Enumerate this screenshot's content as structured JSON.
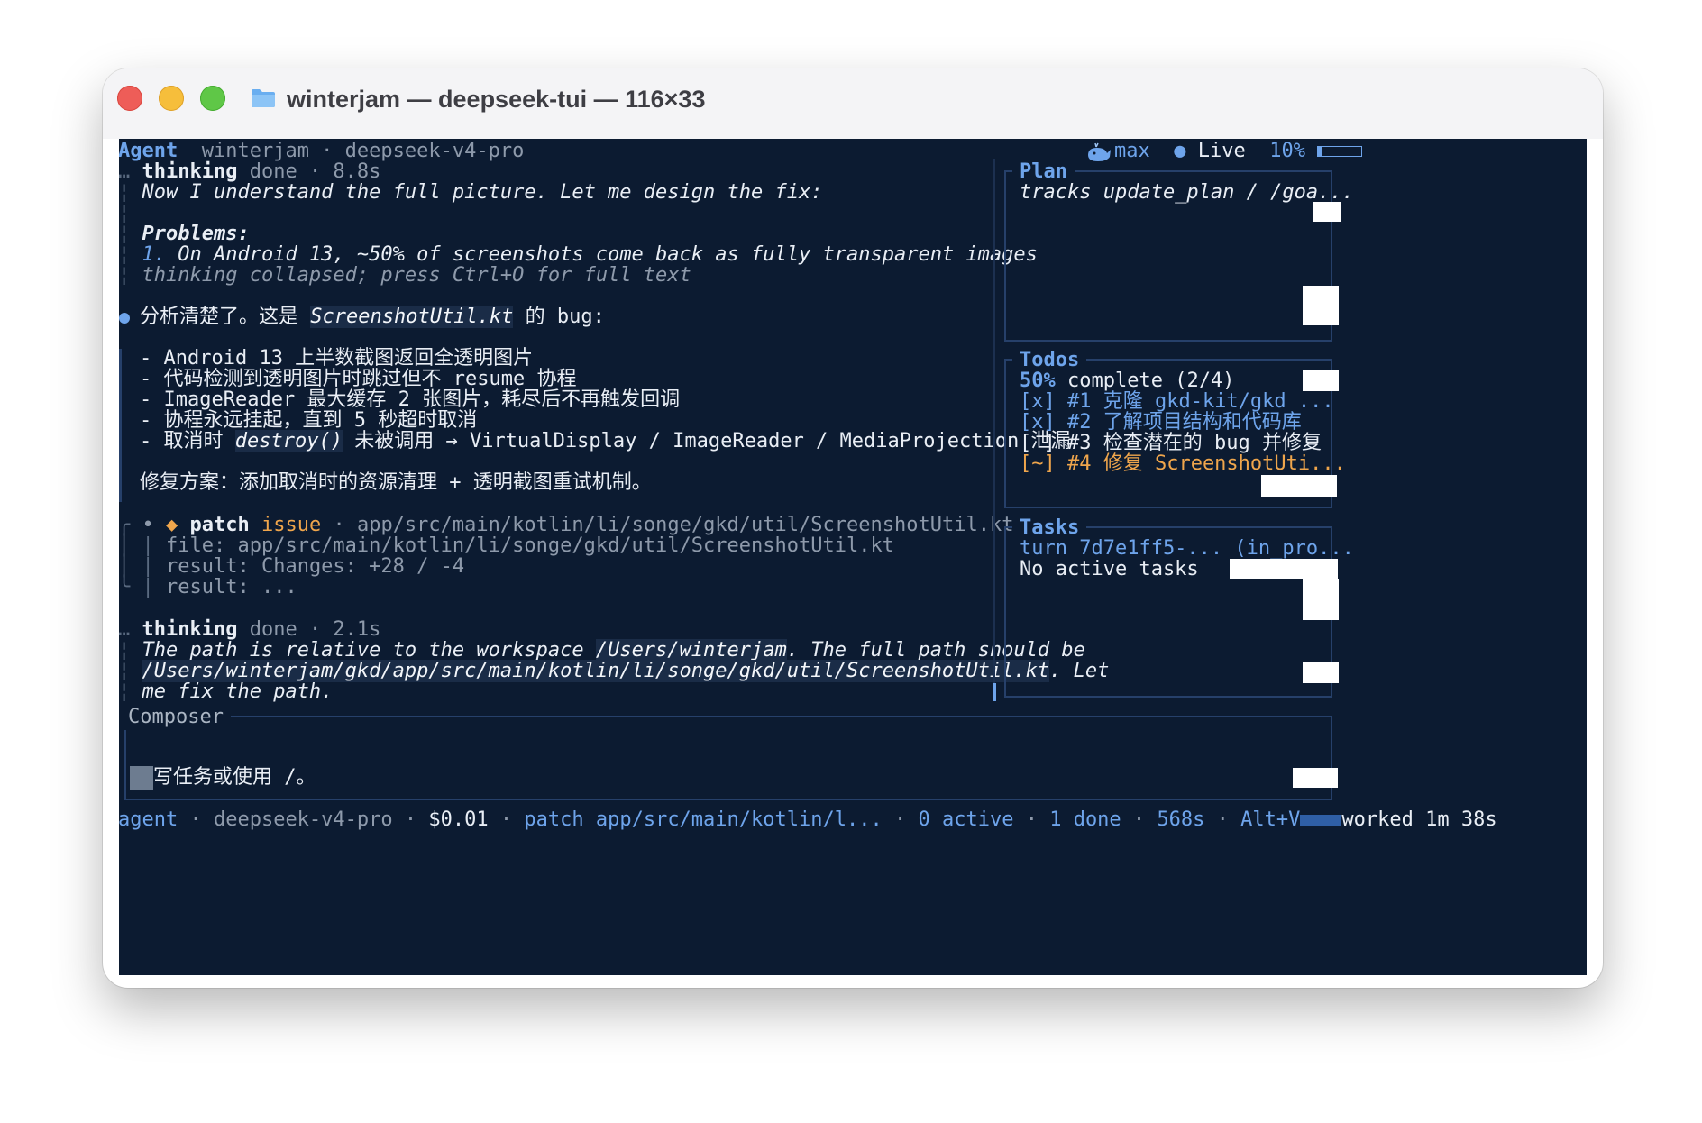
{
  "window": {
    "title": "winterjam — deepseek-tui — 116×33"
  },
  "header": {
    "mode": "Agent",
    "context": "winterjam · deepseek-v4-pro",
    "effort": "max",
    "live_label": "Live",
    "usage_percent": "10%",
    "usage_fraction": 0.1,
    "whale_icon": "whale-icon"
  },
  "transcript": {
    "thinking1": {
      "label": "thinking",
      "status": "done · 8.8s",
      "line1": "Now I understand the full picture. Let me design the fix:",
      "problems_heading": "Problems:",
      "problem1_num": "1.",
      "problem1": " On Android 13, ~50% of screenshots come back as fully transparent images",
      "collapsed_note": "thinking collapsed; press Ctrl+O for full text"
    },
    "message": {
      "intro_prefix": "分析清楚了。这是 ",
      "intro_file": "ScreenshotUtil.kt",
      "intro_suffix": " 的 bug:",
      "bullets": [
        "- Android 13 上半数截图返回全透明图片",
        "- 代码检测到透明图片时跳过但不 resume 协程",
        "- ImageReader 最大缓存 2 张图片，耗尽后不再触发回调",
        "- 协程永远挂起，直到 5 秒超时取消"
      ],
      "bullet5_prefix": "- 取消时 ",
      "bullet5_code": "destroy()",
      "bullet5_suffix": " 未被调用 → VirtualDisplay / ImageReader / MediaProjection 泄漏",
      "fix_plan": "修复方案：添加取消时的资源清理 + 透明截图重试机制。"
    },
    "patch": {
      "label": "patch",
      "status": "issue",
      "path": " · app/src/main/kotlin/li/songe/gkd/util/ScreenshotUtil.kt",
      "file_line": "file: app/src/main/kotlin/li/songe/gkd/util/ScreenshotUtil.kt",
      "result1": "result: Changes: +28 / -4",
      "result2": "result: ..."
    },
    "thinking2": {
      "label": "thinking",
      "status": "done · 2.1s",
      "line1_prefix": "The path is relative to the workspace ",
      "line1_path": "/Users/winterjam",
      "line1_suffix": ". The full path should be",
      "line2_path": "/Users/winterjam/gkd/app/src/main/kotlin/li/songe/gkd/util/ScreenshotUtil.kt",
      "line2_suffix": ". Let",
      "line3": "me fix the path."
    }
  },
  "sidebar": {
    "plan": {
      "title": "Plan",
      "text": "tracks update_plan / /goa..."
    },
    "todos": {
      "title": "Todos",
      "progress_percent": "50%",
      "progress_text": " complete (2/4)",
      "items": [
        {
          "text": "[x] #1 克隆 gkd-kit/gkd ...",
          "state": "done"
        },
        {
          "text": "[x] #2 了解项目结构和代码库",
          "state": "done"
        },
        {
          "text": "[ ] #3 检查潜在的 bug 并修复",
          "state": "pending"
        },
        {
          "text": "[~] #4 修复 ScreenshotUti...",
          "state": "active"
        }
      ]
    },
    "tasks": {
      "title": "Tasks",
      "turn": "turn 7d7e1ff5-... (in_pro...",
      "empty": "No active tasks"
    }
  },
  "composer": {
    "title": "Composer",
    "placeholder": "写任务或使用 /。"
  },
  "status_bar": {
    "mode": "agent",
    "model": " · deepseek-v4-pro · ",
    "cost": "$0.01",
    "sep1": " · ",
    "patch": "patch app/src/main/kotlin/l...",
    "sep2": " · ",
    "active": "0 active",
    "sep3": " · ",
    "done": "1 done",
    "sep4": " · ",
    "elapsed": "568s",
    "sep5": " · ",
    "shortcut": "Alt+V",
    "worked": "worked 1m 38s"
  },
  "colors": {
    "terminal_bg": "#0c1b31",
    "accent_blue": "#6ea4eb",
    "active_orange": "#f0a64c",
    "close": "#ee5d58",
    "minimize": "#f6be3b",
    "maximize": "#5fc747"
  }
}
